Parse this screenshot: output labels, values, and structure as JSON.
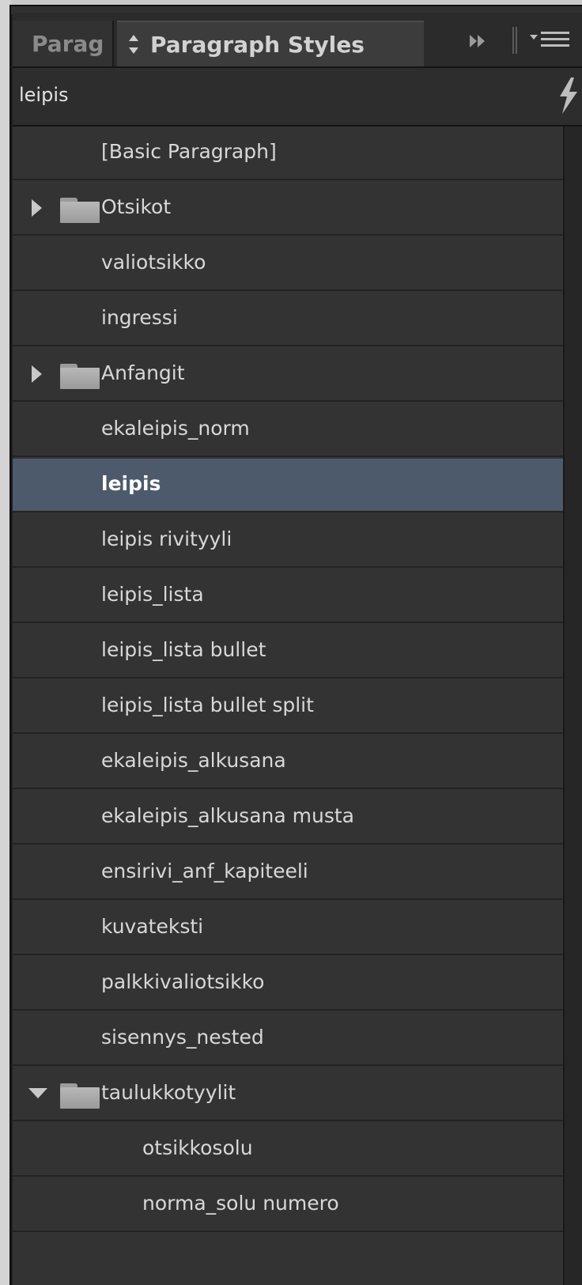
{
  "tabs": {
    "inactive_label": "Parag",
    "active_label": "Paragraph Styles"
  },
  "search": {
    "value": "leipis"
  },
  "styles": [
    {
      "label": "[Basic Paragraph]"
    },
    {
      "label": "Otsikot",
      "type": "folder",
      "expanded": false
    },
    {
      "label": "valiotsikko"
    },
    {
      "label": "ingressi"
    },
    {
      "label": "Anfangit",
      "type": "folder",
      "expanded": false
    },
    {
      "label": "ekaleipis_norm"
    },
    {
      "label": "leipis",
      "selected": true
    },
    {
      "label": "leipis rivityyli"
    },
    {
      "label": "leipis_lista"
    },
    {
      "label": "leipis_lista bullet"
    },
    {
      "label": "leipis_lista bullet split"
    },
    {
      "label": "ekaleipis_alkusana"
    },
    {
      "label": "ekaleipis_alkusana musta"
    },
    {
      "label": "ensirivi_anf_kapiteeli"
    },
    {
      "label": "kuvateksti"
    },
    {
      "label": "palkkivaliotsikko"
    },
    {
      "label": "sisennys_nested"
    },
    {
      "label": "taulukkotyylit",
      "type": "folder",
      "expanded": true
    },
    {
      "label": "otsikkosolu",
      "indent": 1
    },
    {
      "label": "norma_solu numero",
      "indent": 1
    }
  ],
  "colors": {
    "selection": "#4d5a6c",
    "panel": "#333333"
  }
}
